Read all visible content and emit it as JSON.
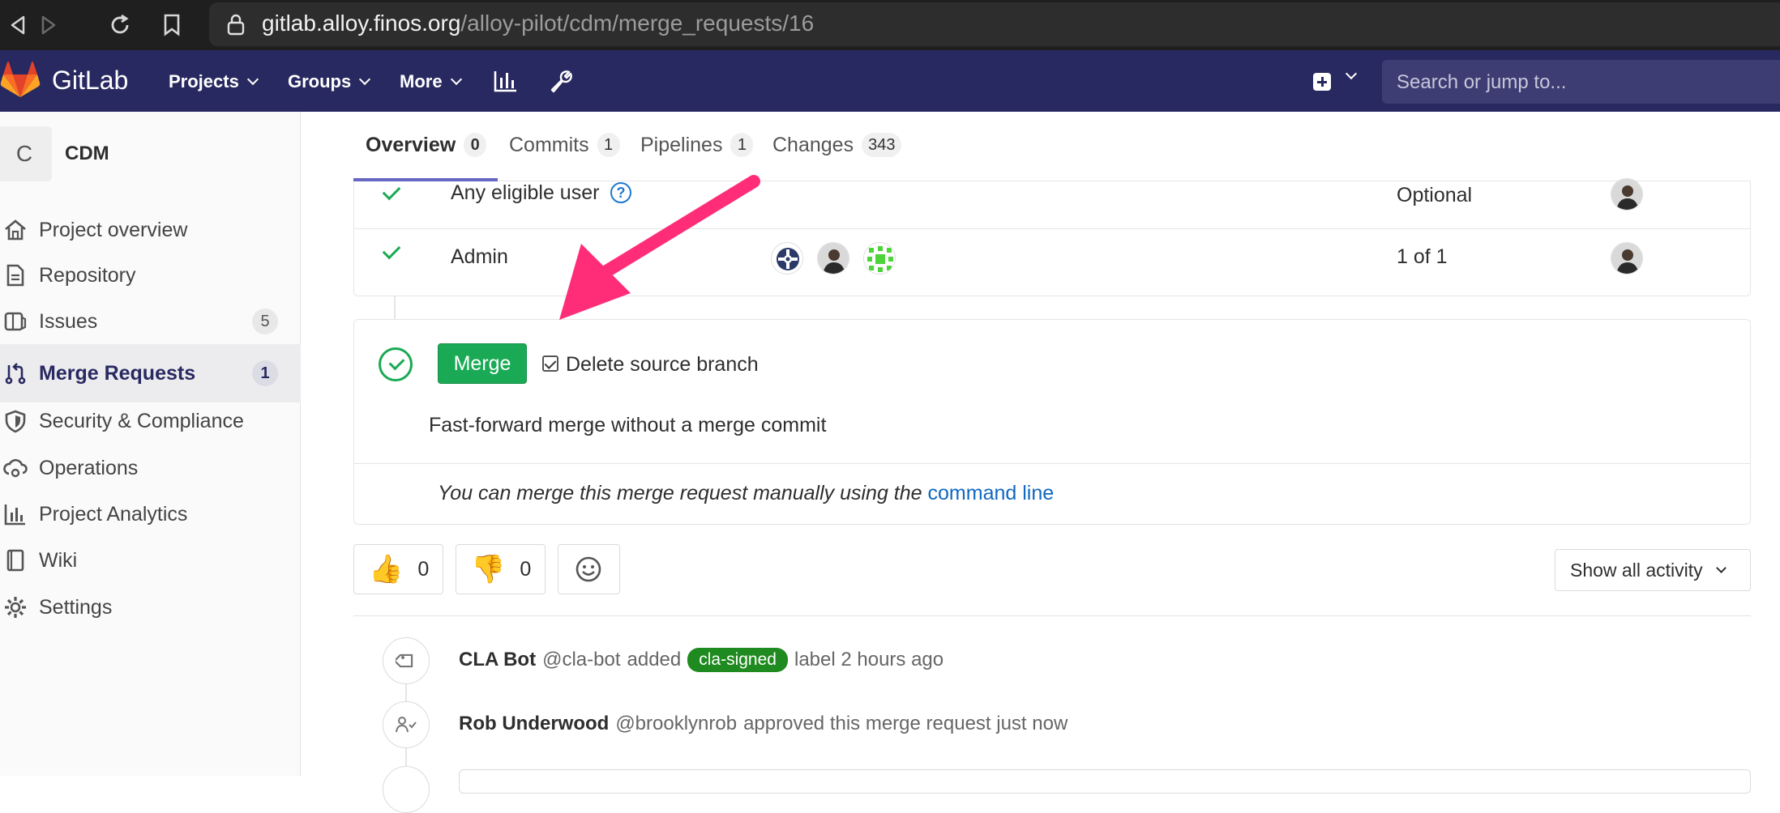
{
  "browser": {
    "url_host": "gitlab.alloy.finos.org",
    "url_path": "/alloy-pilot/cdm/merge_requests/16"
  },
  "header": {
    "brand": "GitLab",
    "menus": [
      "Projects",
      "Groups",
      "More"
    ],
    "search_placeholder": "Search or jump to..."
  },
  "sidebar": {
    "avatar_letter": "C",
    "project_name": "CDM",
    "items": [
      {
        "label": "Project overview",
        "icon": "home-icon"
      },
      {
        "label": "Repository",
        "icon": "document-icon"
      },
      {
        "label": "Issues",
        "icon": "issues-icon",
        "count": "5"
      },
      {
        "label": "Merge Requests",
        "icon": "merge-request-icon",
        "count": "1",
        "active": true
      },
      {
        "label": "Security & Compliance",
        "icon": "shield-icon"
      },
      {
        "label": "Operations",
        "icon": "cloud-gear-icon"
      },
      {
        "label": "Project Analytics",
        "icon": "analytics-icon"
      },
      {
        "label": "Wiki",
        "icon": "book-icon"
      },
      {
        "label": "Settings",
        "icon": "gear-icon"
      }
    ]
  },
  "tabs": [
    {
      "label": "Overview",
      "count": "0",
      "active": true
    },
    {
      "label": "Commits",
      "count": "1"
    },
    {
      "label": "Pipelines",
      "count": "1"
    },
    {
      "label": "Changes",
      "count": "343"
    }
  ],
  "approvals": [
    {
      "name": "Any eligible user",
      "status": "Optional"
    },
    {
      "name": "Admin",
      "status": "1 of 1"
    }
  ],
  "merge_widget": {
    "merge_label": "Merge",
    "delete_branch_label": "Delete source branch",
    "delete_branch_checked": true,
    "ff_text": "Fast-forward merge without a merge commit",
    "manual_text": "You can merge this merge request manually using the",
    "manual_link": "command line"
  },
  "awards": {
    "thumbsup": "0",
    "thumbsdown": "0"
  },
  "activity_filter": "Show all activity",
  "timeline": [
    {
      "author": "CLA Bot",
      "handle": "@cla-bot",
      "pre": "added",
      "label": "cla-signed",
      "post": "label 2 hours ago"
    },
    {
      "author": "Rob Underwood",
      "handle": "@brooklynrob",
      "pre": "approved this merge request just now"
    }
  ],
  "colors": {
    "header": "#292961",
    "merge_green": "#1aaa55",
    "link": "#1068bf",
    "arrow": "#ff2d78",
    "label_green": "#1f8a1f"
  }
}
